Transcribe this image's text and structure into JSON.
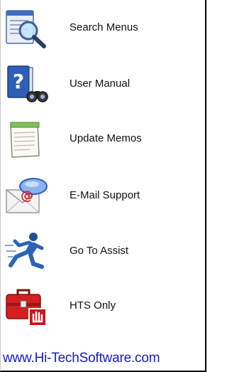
{
  "menu": {
    "items": [
      {
        "label": "Search Menus",
        "icon": "search-menus-icon"
      },
      {
        "label": "User Manual",
        "icon": "user-manual-icon"
      },
      {
        "label": "Update Memos",
        "icon": "update-memos-icon"
      },
      {
        "label": "E-Mail Support",
        "icon": "email-support-icon"
      },
      {
        "label": "Go To Assist",
        "icon": "go-to-assist-icon"
      },
      {
        "label": "HTS Only",
        "icon": "hts-only-icon"
      }
    ]
  },
  "footer": {
    "link_text": "www.Hi-TechSoftware.com"
  },
  "colors": {
    "link": "#1a1ac8",
    "frame": "#000000"
  }
}
